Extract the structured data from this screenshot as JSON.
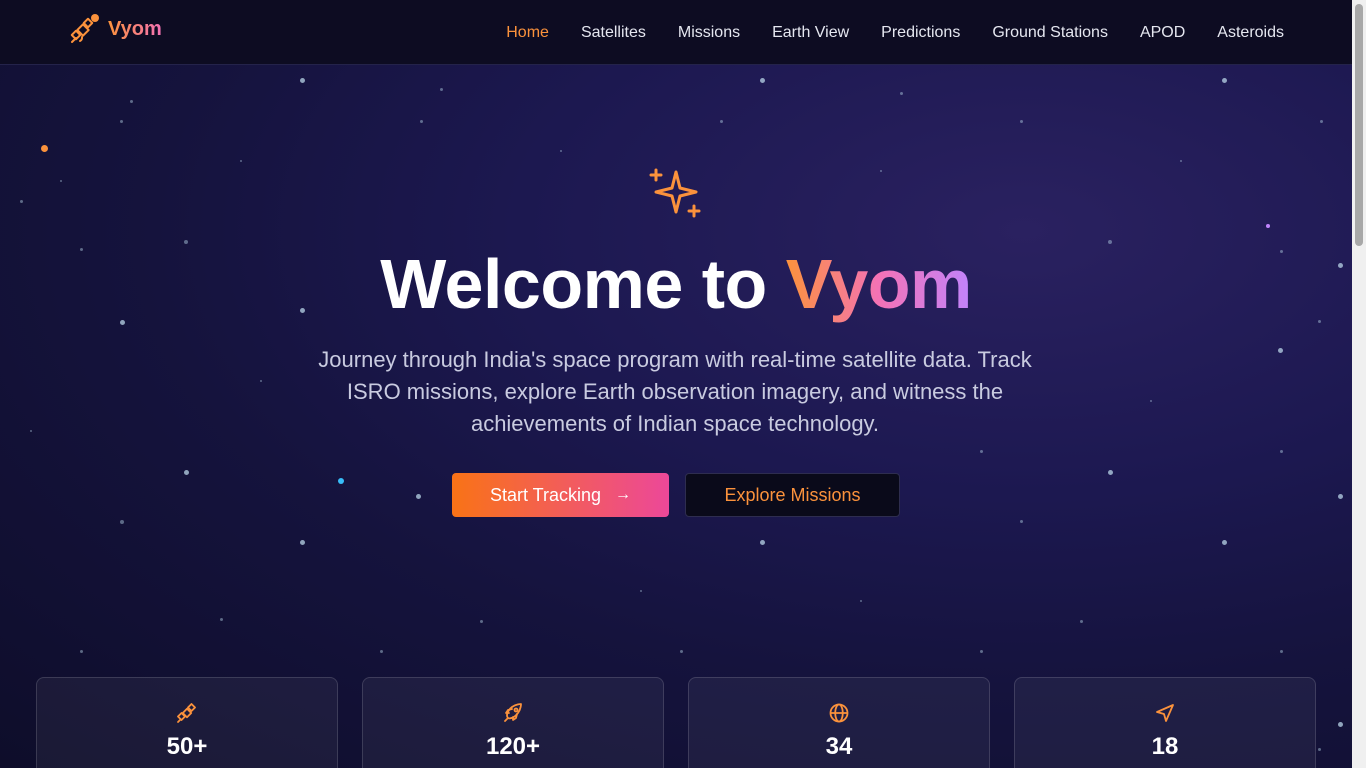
{
  "brand": {
    "name": "Vyom",
    "logo_icon": "satellite-icon",
    "color_start": "#fb923c",
    "color_end": "#f472b6"
  },
  "nav": {
    "items": [
      {
        "label": "Home",
        "active": true
      },
      {
        "label": "Satellites",
        "active": false
      },
      {
        "label": "Missions",
        "active": false
      },
      {
        "label": "Earth View",
        "active": false
      },
      {
        "label": "Predictions",
        "active": false
      },
      {
        "label": "Ground Stations",
        "active": false
      },
      {
        "label": "APOD",
        "active": false
      },
      {
        "label": "Asteroids",
        "active": false
      }
    ]
  },
  "hero": {
    "icon": "sparkles-icon",
    "title_prefix": "Welcome to ",
    "title_accent": "Vyom",
    "subtitle": "Journey through India's space program with real-time satellite data. Track ISRO missions, explore Earth observation imagery, and witness the achievements of Indian space technology.",
    "primary_button": "Start Tracking",
    "primary_button_icon": "arrow-right-icon",
    "secondary_button": "Explore Missions"
  },
  "stats": [
    {
      "icon": "satellite-icon",
      "value": "50+"
    },
    {
      "icon": "rocket-icon",
      "value": "120+"
    },
    {
      "icon": "globe-icon",
      "value": "34"
    },
    {
      "icon": "navigation-icon",
      "value": "18"
    }
  ],
  "colors": {
    "accent_orange": "#fb923c",
    "accent_pink": "#ec4899",
    "background": "#15133d",
    "navbar": "#0d0c22"
  }
}
